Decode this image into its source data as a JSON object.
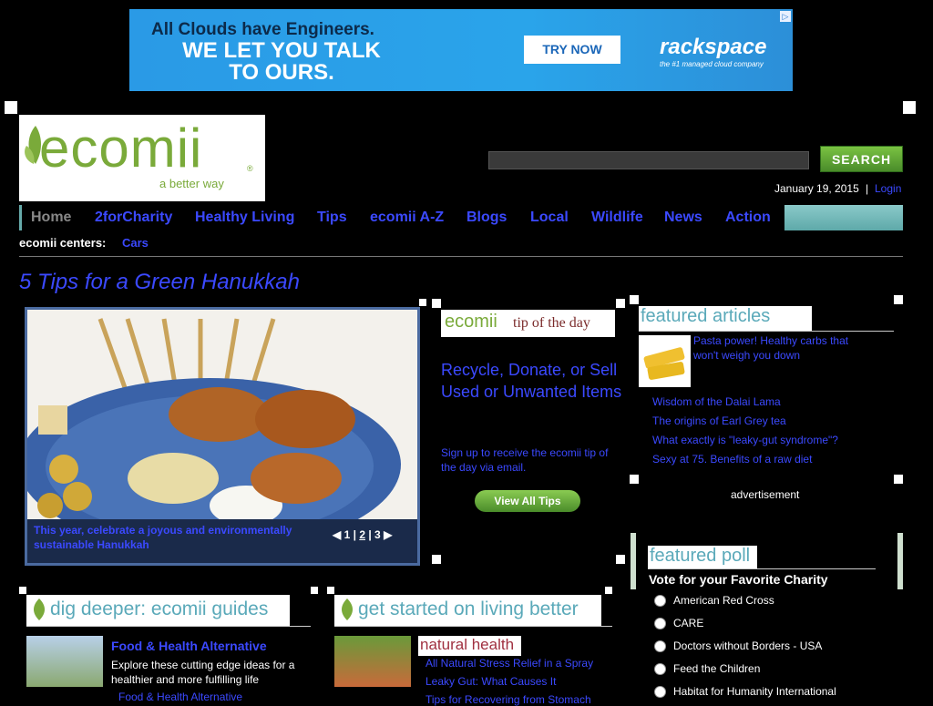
{
  "ad": {
    "line1": "All Clouds have Engineers.",
    "line2": "WE LET YOU TALK TO OURS.",
    "cta": "TRY NOW",
    "brand": "rackspace",
    "brand_tag": "the #1 managed cloud company"
  },
  "logo": {
    "word": "ecomii",
    "tagline": "a better way",
    "reg": "®"
  },
  "header": {
    "search_button": "SEARCH",
    "date": "January 19, 2015",
    "separator": "|",
    "login": "Login"
  },
  "nav": [
    "Home",
    "2forCharity",
    "Healthy Living",
    "Tips",
    "ecomii A-Z",
    "Blogs",
    "Local",
    "Wildlife",
    "News",
    "Action"
  ],
  "centers": {
    "label": "ecomii centers:",
    "link": "Cars"
  },
  "headline": "5 Tips for a Green Hanukkah",
  "feature": {
    "caption": "This year, celebrate a joyous and environmentally sustainable Hanukkah",
    "pages": [
      "1",
      "2",
      "3"
    ],
    "sep": "|"
  },
  "tip": {
    "brand": "ecomii",
    "head": "tip of the day",
    "title": "Recycle, Donate, or Sell Used or Unwanted Items",
    "signup": "Sign up to receive the ecomii tip of the day via email.",
    "button": "View All Tips"
  },
  "featured_articles": {
    "heading": "featured articles",
    "first": "Pasta power! Healthy carbs that won't weigh you down",
    "items": [
      "Wisdom of the Dalai Lama",
      "The origins of Earl Grey tea",
      "What exactly is \"leaky-gut syndrome\"?",
      "Sexy at 75. Benefits of a raw diet"
    ]
  },
  "advertisement": "advertisement",
  "poll": {
    "heading": "featured poll",
    "question": "Vote for your Favorite Charity",
    "options": [
      "American Red Cross",
      "CARE",
      "Doctors without Borders - USA",
      "Feed the Children",
      "Habitat for Humanity International"
    ]
  },
  "dig_deeper": {
    "heading": "dig deeper: ecomii guides",
    "title": "Food & Health Alternative",
    "desc": "Explore these cutting edge ideas for a healthier and more fulfilling life",
    "link": "Food & Health Alternative"
  },
  "get_started": {
    "heading": "get started on living better",
    "subhead": "natural health",
    "items": [
      "All Natural Stress Relief in a Spray",
      "Leaky Gut: What Causes It",
      "Tips for Recovering from Stomach"
    ]
  }
}
